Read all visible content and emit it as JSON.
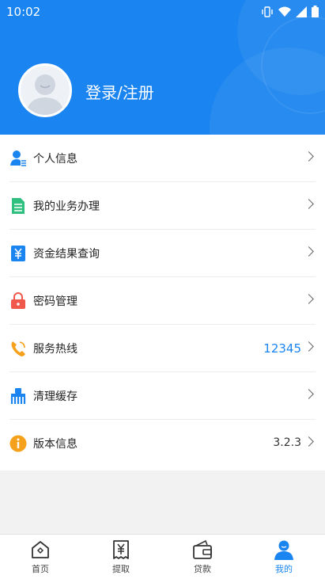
{
  "status_bar": {
    "time": "10:02"
  },
  "profile": {
    "login_label": "登录/注册"
  },
  "menu": [
    {
      "label": "个人信息",
      "value": ""
    },
    {
      "label": "我的业务办理",
      "value": ""
    },
    {
      "label": "资金结果查询",
      "value": ""
    },
    {
      "label": "密码管理",
      "value": ""
    },
    {
      "label": "服务热线",
      "value": "12345"
    },
    {
      "label": "清理缓存",
      "value": ""
    },
    {
      "label": "版本信息",
      "value": "3.2.3"
    }
  ],
  "tabs": [
    {
      "label": "首页",
      "icon": "home-icon"
    },
    {
      "label": "提取",
      "icon": "yuan-receipt-icon"
    },
    {
      "label": "贷款",
      "icon": "wallet-icon"
    },
    {
      "label": "我的",
      "icon": "user-icon",
      "active": true
    }
  ],
  "colors": {
    "primary": "#1a84f0",
    "background": "#f2f2f2"
  }
}
